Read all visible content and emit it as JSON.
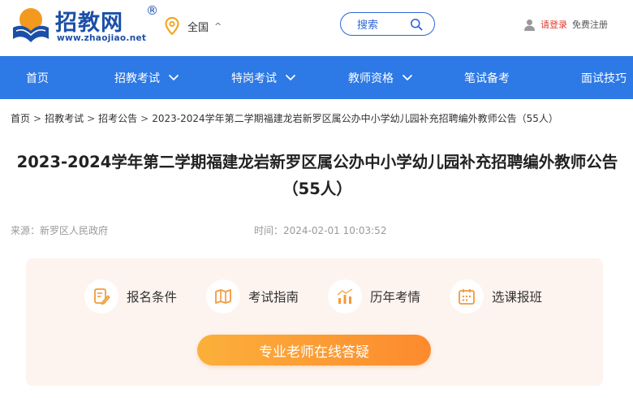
{
  "header": {
    "logo_text": "招教网",
    "logo_reg": "®",
    "logo_url": "www.zhaojiao.net",
    "location": "全国",
    "search_label": "搜索",
    "login": "请登录",
    "register": "免费注册"
  },
  "nav": {
    "items": [
      {
        "label": "首页",
        "dropdown": false
      },
      {
        "label": "招教考试",
        "dropdown": true
      },
      {
        "label": "特岗考试",
        "dropdown": true
      },
      {
        "label": "教师资格",
        "dropdown": true
      },
      {
        "label": "笔试备考",
        "dropdown": false
      },
      {
        "label": "面试技巧",
        "dropdown": false
      }
    ]
  },
  "breadcrumb": {
    "items": [
      "首页",
      "招教考试",
      "招考公告",
      "2023-2024学年第二学期福建龙岩新罗区属公办中小学幼儿园补充招聘编外教师公告（55人）"
    ],
    "separator": ">"
  },
  "article": {
    "title": "2023-2024学年第二学期福建龙岩新罗区属公办中小学幼儿园补充招聘编外教师公告（55人）",
    "source": "来源：新罗区人民政府",
    "time": "时间：2024-02-01 10:03:52"
  },
  "card": {
    "features": [
      {
        "label": "报名条件",
        "icon": "form-edit-icon"
      },
      {
        "label": "考试指南",
        "icon": "map-guide-icon"
      },
      {
        "label": "历年考情",
        "icon": "bar-chart-icon"
      },
      {
        "label": "选课报班",
        "icon": "calendar-icon"
      }
    ],
    "cta": "专业老师在线答疑"
  },
  "colors": {
    "brand_blue": "#2d79e6",
    "logo_blue": "#1b4fa8",
    "accent_orange": "#fd8a2e",
    "login_red": "#e23b2e",
    "card_bg": "#fdf3ef"
  }
}
